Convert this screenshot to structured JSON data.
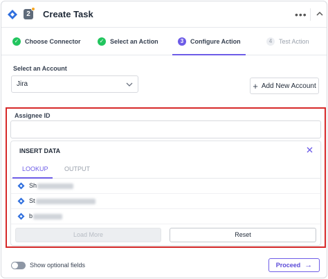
{
  "header": {
    "title": "Create Task",
    "step_number": "2",
    "more_icon": "more-horizontal-icon",
    "collapse_icon": "collapse-icon",
    "app_icon": "jira-icon"
  },
  "stepper": {
    "steps": [
      {
        "label": "Choose Connector",
        "status": "done",
        "marker": "✓"
      },
      {
        "label": "Select an Action",
        "status": "done",
        "marker": "✓"
      },
      {
        "label": "Configure Action",
        "status": "active",
        "marker": "3"
      },
      {
        "label": "Test Action",
        "status": "pending",
        "marker": "4"
      }
    ]
  },
  "account": {
    "label": "Select an Account",
    "selected": "Jira",
    "add_button": "Add New Account"
  },
  "assignee": {
    "label": "Assignee ID",
    "value": ""
  },
  "insert_data": {
    "title": "INSERT DATA",
    "tabs": [
      {
        "label": "LOOKUP",
        "active": true
      },
      {
        "label": "OUTPUT",
        "active": false
      }
    ],
    "items": [
      {
        "prefix": "Sh"
      },
      {
        "prefix": "St"
      },
      {
        "prefix": "b"
      }
    ],
    "load_more_label": "Load More",
    "reset_label": "Reset"
  },
  "footer": {
    "toggle_label": "Show optional fields",
    "toggle_on": false,
    "proceed_label": "Proceed"
  },
  "colors": {
    "accent": "#6d5ce7",
    "success": "#22c55e",
    "highlight": "#d62828"
  }
}
